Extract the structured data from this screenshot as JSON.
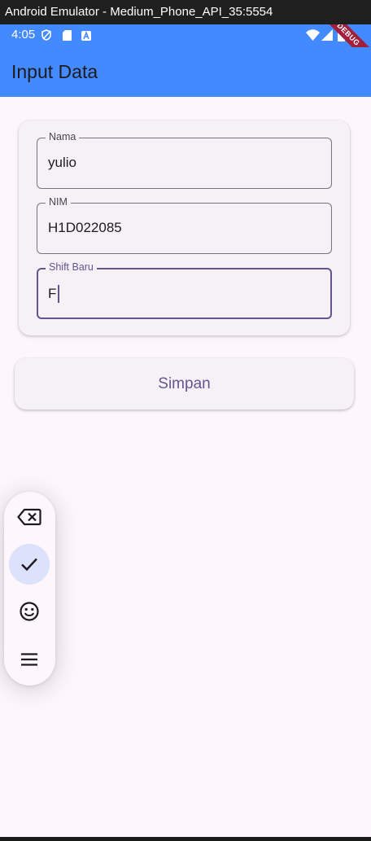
{
  "window": {
    "title": "Android Emulator - Medium_Phone_API_35:5554"
  },
  "status_bar": {
    "time": "4:05",
    "debug_banner": "DEBUG"
  },
  "app_bar": {
    "title": "Input Data"
  },
  "form": {
    "fields": [
      {
        "label": "Nama",
        "value": "yulio"
      },
      {
        "label": "NIM",
        "value": "H1D022085"
      },
      {
        "label": "Shift Baru",
        "value": "F"
      }
    ]
  },
  "actions": {
    "save_label": "Simpan"
  },
  "keyboard_toolbar": {
    "items": [
      "backspace-icon",
      "check-icon",
      "emoji-icon",
      "menu-icon"
    ],
    "active_item": "check-icon"
  },
  "colors": {
    "app_bar": "#448aff",
    "primary": "#65558f",
    "surface": "#fdf7fd",
    "card": "#f6f1f7",
    "debug_ribbon": "#a0203c"
  }
}
